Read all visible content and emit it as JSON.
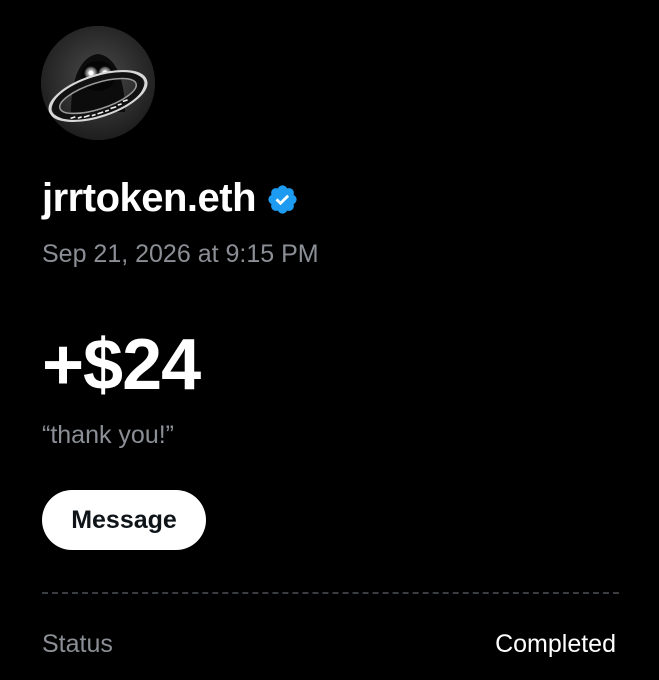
{
  "profile": {
    "display_name": "jrrtoken.eth",
    "verified_icon": "verified-badge-icon",
    "avatar_icon": "glowing-eyes-figure-with-ring-avatar",
    "avatar_ring_text": "crypto nft eth"
  },
  "transaction": {
    "timestamp": "Sep 21, 2026 at 9:15 PM",
    "amount": "+$24",
    "note": "“thank you!”"
  },
  "actions": {
    "message_label": "Message"
  },
  "details": {
    "status_label": "Status",
    "status_value": "Completed"
  },
  "colors": {
    "background": "#000000",
    "primary_text": "#ffffff",
    "secondary_text": "#8b8f95",
    "verified_blue": "#1d9bf0",
    "button_bg": "#ffffff",
    "button_text": "#0f1419"
  }
}
